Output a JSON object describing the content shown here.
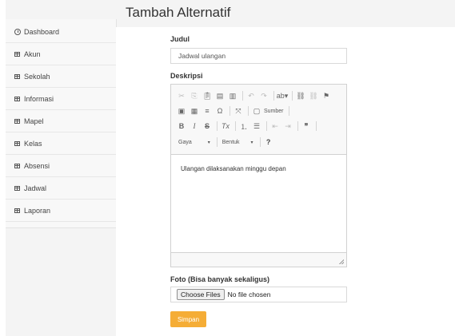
{
  "page": {
    "title": "Tambah Alternatif"
  },
  "sidebar": {
    "items": [
      {
        "label": "Dashboard",
        "icon": "dashboard-icon"
      },
      {
        "label": "Akun",
        "icon": "table-icon"
      },
      {
        "label": "Sekolah",
        "icon": "table-icon"
      },
      {
        "label": "Informasi",
        "icon": "table-icon"
      },
      {
        "label": "Mapel",
        "icon": "table-icon"
      },
      {
        "label": "Kelas",
        "icon": "table-icon"
      },
      {
        "label": "Absensi",
        "icon": "table-icon"
      },
      {
        "label": "Jadwal",
        "icon": "table-icon"
      },
      {
        "label": "Laporan",
        "icon": "table-icon"
      }
    ]
  },
  "form": {
    "judul_label": "Judul",
    "judul_value": "Jadwal ulangan",
    "deskripsi_label": "Deskripsi",
    "editor": {
      "source_label": "Sumber",
      "format_combo": "Gaya",
      "format_combo2": "Bentuk",
      "help": "?",
      "content": "Ulangan dilaksanakan minggu depan"
    },
    "foto_label": "Foto (Bisa banyak sekaligus)",
    "file_button": "Choose Files",
    "file_status": "No file chosen",
    "save_label": "Simpan"
  },
  "colors": {
    "accent": "#f5ad36",
    "background": "#f4f4f4"
  }
}
